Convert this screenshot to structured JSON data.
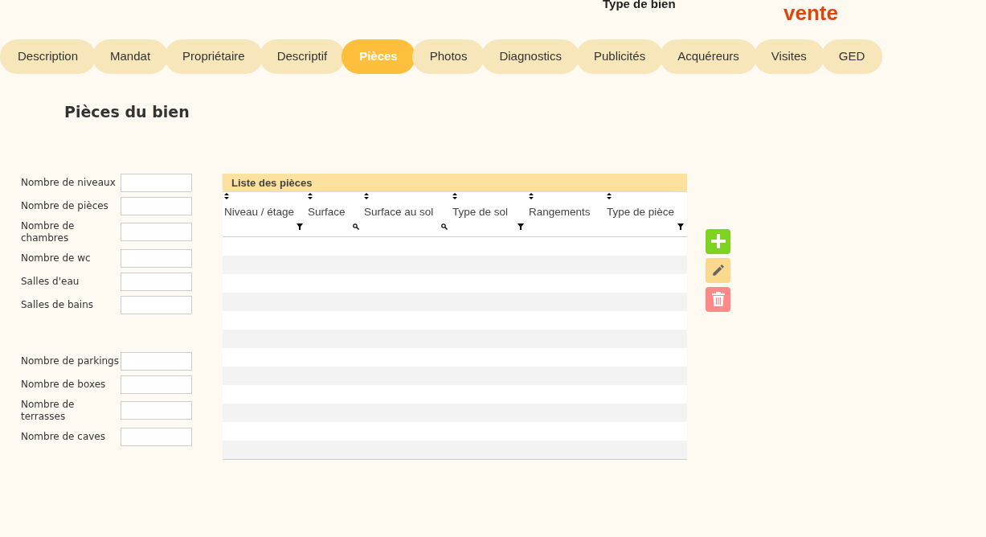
{
  "header": {
    "label": "Type de bien",
    "value": "vente"
  },
  "tabs": [
    {
      "label": "Description",
      "selected": false
    },
    {
      "label": "Mandat",
      "selected": false
    },
    {
      "label": "Propriétaire",
      "selected": false
    },
    {
      "label": "Descriptif",
      "selected": false
    },
    {
      "label": "Pièces",
      "selected": true
    },
    {
      "label": "Photos",
      "selected": false
    },
    {
      "label": "Diagnostics",
      "selected": false
    },
    {
      "label": "Publicités",
      "selected": false
    },
    {
      "label": "Acquéreurs",
      "selected": false
    },
    {
      "label": "Visites",
      "selected": false
    },
    {
      "label": "GED",
      "selected": false
    }
  ],
  "section_title": "Pièces du bien",
  "field_groups": [
    [
      {
        "label": "Nombre de niveaux"
      },
      {
        "label": "Nombre de pièces"
      },
      {
        "label": "Nombre de chambres"
      },
      {
        "label": "Nombre de wc"
      },
      {
        "label": "Salles d'eau"
      },
      {
        "label": "Salles de bains"
      }
    ],
    [
      {
        "label": "Nombre de parkings"
      },
      {
        "label": "Nombre de boxes"
      },
      {
        "label": "Nombre de terrasses"
      },
      {
        "label": "Nombre de caves"
      }
    ]
  ],
  "table": {
    "title": "Liste des pièces",
    "columns": [
      {
        "label": "Niveau / étage",
        "kind": "filter"
      },
      {
        "label": "Surface",
        "kind": "search"
      },
      {
        "label": "Surface au sol",
        "kind": "search"
      },
      {
        "label": "Type de sol",
        "kind": "filter"
      },
      {
        "label": "Rangements",
        "kind": "plain"
      },
      {
        "label": "Type de pièce",
        "kind": "filter"
      }
    ]
  },
  "actions": [
    {
      "kind": "add"
    },
    {
      "kind": "edit"
    },
    {
      "kind": "delete"
    }
  ]
}
